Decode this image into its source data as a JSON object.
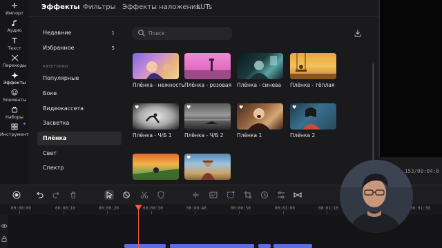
{
  "left_rail": {
    "items": [
      {
        "label": "Импорт",
        "icon": "plus-icon"
      },
      {
        "label": "Аудио",
        "icon": "music-note-icon"
      },
      {
        "label": "Текст",
        "icon": "text-icon"
      },
      {
        "label": "Переходы",
        "icon": "transitions-icon"
      },
      {
        "label": "Эффекты",
        "icon": "effects-sparkle-icon",
        "active": true
      },
      {
        "label": "Элементы",
        "icon": "smiley-icon"
      },
      {
        "label": "Наборы",
        "icon": "bundle-icon"
      },
      {
        "label": "Инструменты",
        "icon": "tools-grid-icon"
      }
    ]
  },
  "tabs": [
    {
      "label": "Эффекты",
      "active": true
    },
    {
      "label": "Фильтры"
    },
    {
      "label": "Эффекты наложения"
    },
    {
      "label": "LUTs"
    }
  ],
  "sidebar": {
    "recent": {
      "label": "Недавние",
      "count": "1"
    },
    "favorites": {
      "label": "Избранное",
      "count": "5"
    },
    "section_title": "КАТЕГОРИИ",
    "categories": [
      "Популярные",
      "Боке",
      "Видеокассета",
      "Засветка",
      "Плёнка",
      "Свет",
      "Спектр"
    ],
    "active_category": "Плёнка"
  },
  "search": {
    "placeholder": "Поиск",
    "value": ""
  },
  "effects": [
    {
      "label": "Плёнка - нежность",
      "favorite": false
    },
    {
      "label": "Плёнка - розовая",
      "favorite": false
    },
    {
      "label": "Плёнка - синева",
      "favorite": false
    },
    {
      "label": "Плёнка - тёплая",
      "favorite": false
    },
    {
      "label": "Плёнка - Ч/Б 1",
      "favorite": true
    },
    {
      "label": "Плёнка - Ч/Б 2",
      "favorite": true
    },
    {
      "label": "Плёнка 1",
      "favorite": true
    },
    {
      "label": "Плёнка 2",
      "favorite": true
    },
    {
      "label": "",
      "favorite": false
    },
    {
      "label": "",
      "favorite": true
    }
  ],
  "preview": {
    "timecode": "153/00:04:0"
  },
  "toolbar": {
    "tools": [
      "record-icon",
      "undo-icon",
      "redo-icon",
      "delete-icon",
      "select-arrow-icon",
      "link-icon",
      "scissors-icon",
      "shield-icon",
      "audio-wave-icon",
      "caption-icon",
      "ai-icon",
      "crop-icon",
      "speed-icon",
      "adjust-icon",
      "bowtie-icon"
    ]
  },
  "ruler": {
    "labels": [
      "00:00:00",
      "00:00:10",
      "00:00:20",
      "00:00:30",
      "00:00:40",
      "00:00:50",
      "00:01:00",
      "00:01:10",
      "00:01:30"
    ]
  },
  "colors": {
    "accent": "#6a6af5",
    "playhead": "#ff5a3a",
    "clip": "#5a6ee0"
  }
}
